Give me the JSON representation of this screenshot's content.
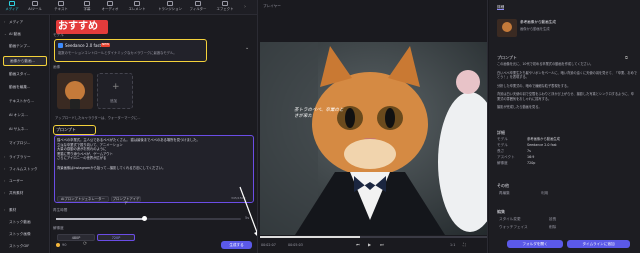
{
  "topbar": {
    "tabs": [
      {
        "label": "メディア",
        "icon": "media-icon",
        "active": true
      },
      {
        "label": "AIツール",
        "icon": "ai-tools-icon"
      },
      {
        "label": "テキスト",
        "icon": "text-icon"
      },
      {
        "label": "字幕",
        "icon": "subtitle-icon"
      },
      {
        "label": "オーディオ",
        "icon": "audio-icon"
      },
      {
        "label": "エレメント",
        "icon": "element-icon"
      },
      {
        "label": "トランジション",
        "icon": "transition-icon"
      },
      {
        "label": "フィルター",
        "icon": "filter-icon"
      },
      {
        "label": "エフェクト",
        "icon": "effect-icon"
      }
    ]
  },
  "sidebar": {
    "items": [
      {
        "label": "メディア",
        "chevron": "›"
      },
      {
        "label": "AI 動画",
        "chevron": "⌄"
      },
      {
        "label": "動画テンプ..."
      },
      {
        "label": "画像から動画..."
      },
      {
        "label": "動画スタイ..."
      },
      {
        "label": "動画を編集..."
      },
      {
        "label": "テキストから..."
      },
      {
        "label": "AI オンス..."
      },
      {
        "label": "AI サムネ..."
      },
      {
        "label": "マイプロジ..."
      },
      {
        "label": "ライブラリー",
        "chevron": "›"
      },
      {
        "label": "フィルムストック",
        "chevron": "›"
      },
      {
        "label": "ユーザー",
        "chevron": "›"
      },
      {
        "label": "共有素材",
        "chevron": "›"
      },
      {
        "label": "素材",
        "chevron": "›"
      },
      {
        "label": "ストック動画"
      },
      {
        "label": "ストック画像"
      },
      {
        "label": "ストックGIF"
      }
    ]
  },
  "panel": {
    "heading": "画像から動画...",
    "overlay_text": "おすすめ",
    "model_label": "モデル",
    "model": {
      "name": "Seedance 2.0 fast",
      "badge": "NEW",
      "desc": "複数のモーションコントロールとダイナミックなカメラワークに最適なモデル。"
    },
    "image_label": "画像",
    "add_label": "追加",
    "note": "アップロードしたキャラクターは、ウォーターマークに...",
    "prompt_label": "プロンプト",
    "prompt_text": "猫ペペの卒業式。主人公であるペペがたくさん。 猫は最後までペペのある場所を見つけました。\n立派な卒業式で振り向いて、アニメーション\n大量の感動の涙がお別れのように\n黒猫に寄り添うペペが、ゲームアウト\nさらにアイロニーの世界が広がる\n\n背景画像はInstagramから拾って...撮影してくれる方法にしてください。",
    "prompt_tags": [
      "AIプロンプトジェネレーター",
      "プロンプトアイデア"
    ],
    "prompt_count": "345/1500",
    "duration_label": "再生時間",
    "duration_value": "5s",
    "resolution_label": "解像度",
    "resolution_options": [
      "480P",
      "720P"
    ],
    "credits": "90",
    "generate_label": "生成する"
  },
  "player": {
    "title": "プレイヤー",
    "overlay_caption": "茶トラのペペ、卒業のときが来た",
    "time_current": "00:02:07",
    "time_total": "00:05:03",
    "zoom": "1:1"
  },
  "props": {
    "tab": "詳細",
    "item_title": "参考画像から動画生成",
    "item_sub": "画像から動画を生成",
    "prompt_title": "プロンプト",
    "prompt_text": "この画像を元に、10代で初める卒業式の動画を作成してください。\n\n白いペペ卒業生たち髪やリボンをベールに、暗い背景の遠くに天使の羽を見せて、「卒業、おめでとう！」を表現する。\n\n分析した卒業式の、暗めで繊細な粒子表現をする。\n\n背景は白い天使の羽で空間をふわりと浮かび上がらせ、撮影した写真とシンクロするように、卒業式の雰囲気をおしゃれに描写する。\n\n撮影が完成したら動画を見る。",
    "details_title": "詳細",
    "details": [
      {
        "k": "モデル",
        "v": "参考画像から動画生成"
      },
      {
        "k": "モデル",
        "v": "Seedance 2.0 fast"
      },
      {
        "k": "長さ",
        "v": "7s"
      },
      {
        "k": "アスペクト",
        "v": "16:9"
      },
      {
        "k": "解像度",
        "v": "720p"
      }
    ],
    "others_title": "その他",
    "others": [
      "再編集",
      "利用"
    ],
    "edit_title": "編集",
    "edit_items": [
      "スタイル変更",
      "延長",
      "ウォッチフェイス",
      "削除"
    ],
    "btn_primary": "フォルダを開く",
    "btn_secondary": "タイムラインに追加"
  }
}
